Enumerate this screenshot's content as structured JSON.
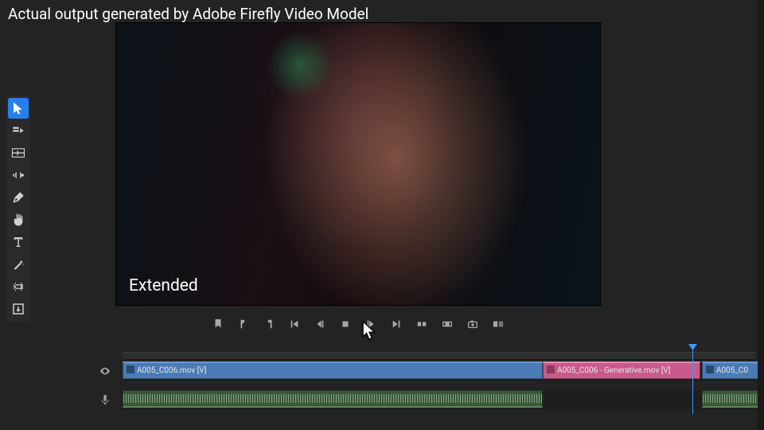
{
  "banner": "Actual output generated by Adobe Firefly Video Model",
  "overlay": "Extended",
  "tools": [
    {
      "name": "selection-tool",
      "active": true
    },
    {
      "name": "track-select-tool"
    },
    {
      "name": "ripple-edit-tool"
    },
    {
      "name": "rolling-edit-tool"
    },
    {
      "name": "pen-tool"
    },
    {
      "name": "hand-tool"
    },
    {
      "name": "type-tool"
    },
    {
      "name": "rate-stretch-tool"
    },
    {
      "name": "slip-tool"
    },
    {
      "name": "remix-tool"
    }
  ],
  "transport": [
    {
      "name": "add-marker"
    },
    {
      "name": "mark-in"
    },
    {
      "name": "mark-out"
    },
    {
      "name": "go-to-in"
    },
    {
      "name": "step-back"
    },
    {
      "name": "play-stop"
    },
    {
      "name": "step-forward"
    },
    {
      "name": "go-to-out"
    },
    {
      "name": "insert"
    },
    {
      "name": "overwrite"
    },
    {
      "name": "export-frame"
    },
    {
      "name": "comparison-view"
    }
  ],
  "clips": {
    "main": "A005_C006.mov [V]",
    "gen": "A005_C006 - Generative.mov [V]",
    "next": "A005_C0"
  },
  "colors": {
    "accent": "#2680eb",
    "videoClip": "#4a7bb5",
    "genClip": "#c95a8a",
    "audioClip": "#3a5838",
    "playhead": "#3a9aff"
  }
}
